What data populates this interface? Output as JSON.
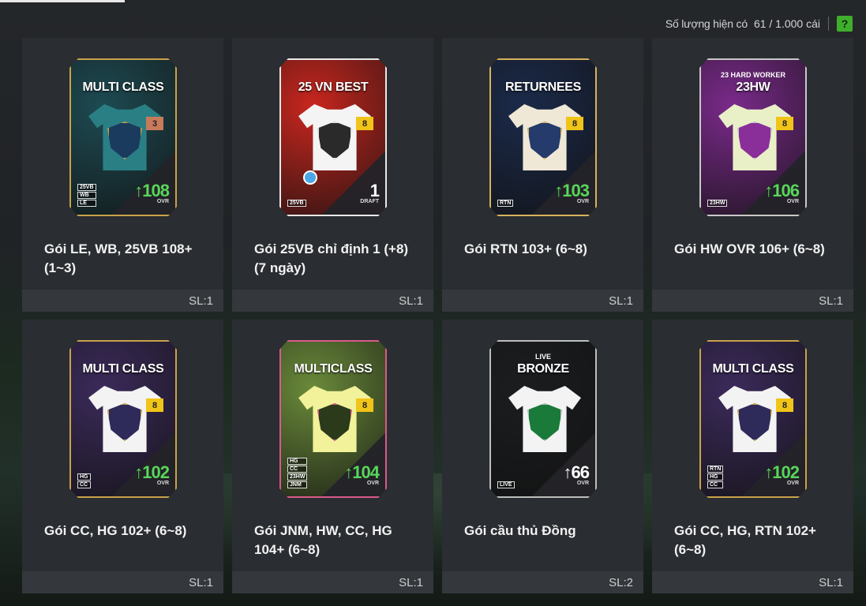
{
  "inventory": {
    "label": "Số lượng hiện có",
    "count": "61 / 1.000 cái",
    "help_label": "?"
  },
  "packs": [
    {
      "title_line1": "Gói LE, WB, 25VB 108+",
      "title_line2": "(1~3)",
      "qty": "SL:1",
      "band": "MULTI CLASS",
      "pre": "",
      "level": "3",
      "ovr": "↑108",
      "ovr_label": "OVR",
      "tags": [
        "25VB",
        "WB",
        "LE"
      ],
      "colors": {
        "bg": "#1d4a52",
        "shirt": "#2a7f84",
        "crest": "#1a3b5e",
        "border": "#c9a24a",
        "lvl": "#c97a5a",
        "ovr": "#58d65a"
      }
    },
    {
      "title_line1": "Gói 25VB chỉ định 1 (+8)",
      "title_line2": "(7 ngày)",
      "qty": "SL:1",
      "band": "25 VN BEST",
      "pre": "",
      "level": "8",
      "ovr": "1",
      "ovr_label": "DRAFT",
      "tags": [
        "25VB"
      ],
      "colors": {
        "bg": "#c8261e",
        "shirt": "#f4f4f4",
        "crest": "#2a2a2a",
        "border": "#e8e8e8",
        "lvl": "#f0c419",
        "ovr": "#ffffff"
      }
    },
    {
      "title_line1": "Gói RTN 103+ (6~8)",
      "title_line2": "",
      "qty": "SL:1",
      "band": "RETURNEES",
      "pre": "",
      "level": "8",
      "ovr": "↑103",
      "ovr_label": "OVR",
      "tags": [
        "RTN"
      ],
      "colors": {
        "bg": "#1b2a4a",
        "shirt": "#efe8d6",
        "crest": "#243b6b",
        "border": "#d7b25a",
        "lvl": "#f0c419",
        "ovr": "#58d65a"
      }
    },
    {
      "title_line1": "Gói HW OVR 106+ (6~8)",
      "title_line2": "",
      "qty": "SL:1",
      "band": "23HW",
      "pre": "23 HARD WORKER",
      "level": "8",
      "ovr": "↑106",
      "ovr_label": "OVR",
      "tags": [
        "23HW"
      ],
      "colors": {
        "bg": "#7a2a8a",
        "shirt": "#e9f0c8",
        "crest": "#8a2e9a",
        "border": "#c8c8c8",
        "lvl": "#f0c419",
        "ovr": "#58d65a"
      }
    },
    {
      "title_line1": "Gói CC, HG 102+ (6~8)",
      "title_line2": "",
      "qty": "SL:1",
      "band": "MULTI CLASS",
      "pre": "",
      "level": "8",
      "ovr": "↑102",
      "ovr_label": "OVR",
      "tags": [
        "HG",
        "CC"
      ],
      "colors": {
        "bg": "#3b2a5a",
        "shirt": "#f3f3f3",
        "crest": "#2e2a5a",
        "border": "#c9a24a",
        "lvl": "#f0c419",
        "ovr": "#58d65a"
      }
    },
    {
      "title_line1": "Gói JNM, HW, CC, HG",
      "title_line2": "104+ (6~8)",
      "qty": "SL:1",
      "band": "MULTICLASS",
      "pre": "",
      "level": "8",
      "ovr": "↑104",
      "ovr_label": "OVR",
      "tags": [
        "HG",
        "CC",
        "23HW",
        "JNM"
      ],
      "colors": {
        "bg": "#6a8a3a",
        "shirt": "#f1f29a",
        "crest": "#2a3a1a",
        "border": "#d85a8a",
        "lvl": "#f0c419",
        "ovr": "#58d65a"
      }
    },
    {
      "title_line1": "Gói cầu thủ Đồng",
      "title_line2": "",
      "qty": "SL:2",
      "band": "BRONZE",
      "pre": "LIVE",
      "level": "",
      "ovr": "↑66",
      "ovr_label": "OVR",
      "tags": [
        "LIVE"
      ],
      "colors": {
        "bg": "#1b1d1f",
        "shirt": "#f3f3f3",
        "crest": "#1a7a3a",
        "border": "#bdbdbd",
        "lvl": "#f0c419",
        "ovr": "#ffffff"
      }
    },
    {
      "title_line1": "Gói CC, HG, RTN 102+",
      "title_line2": "(6~8)",
      "qty": "SL:1",
      "band": "MULTI CLASS",
      "pre": "",
      "level": "8",
      "ovr": "↑102",
      "ovr_label": "OVR",
      "tags": [
        "RTN",
        "HG",
        "CC"
      ],
      "colors": {
        "bg": "#3b2a5a",
        "shirt": "#f3f3f3",
        "crest": "#2e2a5a",
        "border": "#c9a24a",
        "lvl": "#f0c419",
        "ovr": "#58d65a"
      }
    }
  ]
}
